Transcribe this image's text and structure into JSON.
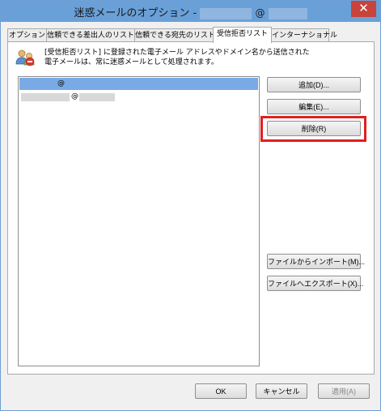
{
  "window": {
    "title": "迷惑メールのオプション -",
    "title_at": "@",
    "close_glyph": "✕"
  },
  "tabs": [
    {
      "label": "オプション",
      "active": false
    },
    {
      "label": "信頼できる差出人のリスト",
      "active": false
    },
    {
      "label": "信頼できる宛先のリスト",
      "active": false
    },
    {
      "label": "受信拒否リスト",
      "active": true
    },
    {
      "label": "インターナショナル",
      "active": false
    }
  ],
  "description": {
    "line1": "[受信拒否リスト] に登録された電子メール アドレスやドメイン名から送信された",
    "line2": "電子メールは、常に迷惑メールとして処理されます。"
  },
  "list": {
    "items": [
      {
        "text": "@",
        "selected": true
      },
      {
        "text": "@",
        "selected": false
      }
    ]
  },
  "buttons": {
    "add": "追加(D)...",
    "edit": "編集(E)...",
    "delete": "削除(R)",
    "import": "ファイルからインポート(M)...",
    "export": "ファイルへエクスポート(X)..."
  },
  "footer": {
    "ok": "OK",
    "cancel": "キャンセル",
    "apply": "適用(A)"
  },
  "colors": {
    "titlebar": "#6aa0d8",
    "selection": "#7aaae5",
    "highlight_box": "#e02020",
    "close_button": "#c7433b"
  }
}
